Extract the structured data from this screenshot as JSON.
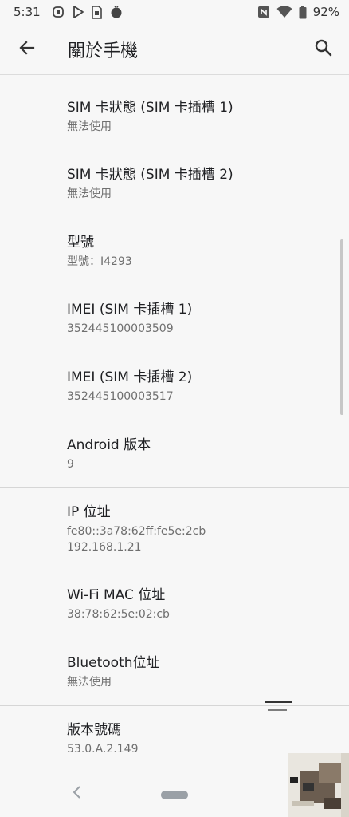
{
  "status_bar": {
    "time": "5:31",
    "battery_percent": "92%",
    "left_icons": [
      "app-notification-icon",
      "play-store-icon",
      "sim-icon",
      "circle-app-icon"
    ],
    "right_icons": [
      "nfc-icon",
      "wifi-icon",
      "battery-icon"
    ]
  },
  "app_bar": {
    "title": "關於手機",
    "back_icon": "arrow-left-icon",
    "search_icon": "search-icon"
  },
  "items": [
    {
      "title": "SIM 卡狀態 (SIM 卡插槽 1)",
      "subtitle": "無法使用"
    },
    {
      "title": "SIM 卡狀態 (SIM 卡插槽 2)",
      "subtitle": "無法使用"
    },
    {
      "title": "型號",
      "subtitle": "型號：I4293"
    },
    {
      "title": "IMEI (SIM 卡插槽 1)",
      "subtitle": "352445100003509"
    },
    {
      "title": "IMEI (SIM 卡插槽 2)",
      "subtitle": "352445100003517"
    },
    {
      "title": "Android 版本",
      "subtitle": "9"
    },
    {
      "title": "IP 位址",
      "subtitle": "fe80::3a78:62ff:fe5e:2cb",
      "subtitle2": "192.168.1.21"
    },
    {
      "title": "Wi-Fi MAC 位址",
      "subtitle": "38:78:62:5e:02:cb"
    },
    {
      "title": "Bluetooth位址",
      "subtitle": "無法使用"
    },
    {
      "title": "版本號碼",
      "subtitle": "53.0.A.2.149"
    }
  ],
  "colors": {
    "background": "#f7f7f7",
    "text_primary": "#202124",
    "text_secondary": "#6f6f6f",
    "divider": "#d6d6d6"
  }
}
